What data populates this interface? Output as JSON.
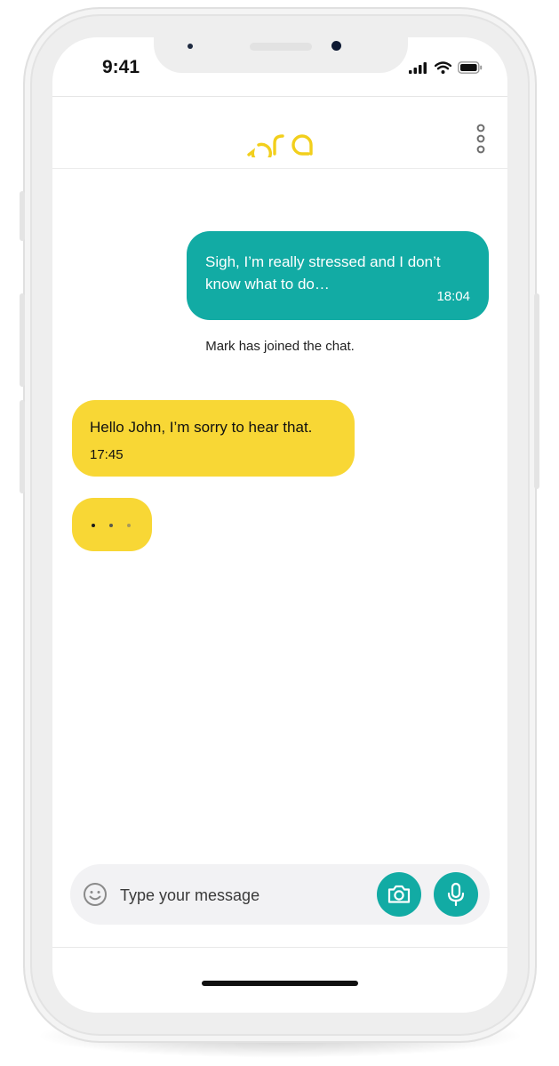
{
  "status_bar": {
    "time": "9:41"
  },
  "header": {
    "logo_text": "ora",
    "menu_icon": "more-vertical-icon"
  },
  "messages": {
    "outgoing": {
      "text": "Sigh, I’m really stressed and I don’t know what to do…",
      "time": "18:04"
    },
    "system": {
      "text": "Mark has joined the chat."
    },
    "incoming": {
      "text": "Hello John, I’m sorry to hear that.",
      "time": "17:45"
    },
    "typing_indicator": {
      "icon": "typing-dots-icon"
    }
  },
  "composer": {
    "placeholder": "Type your message",
    "emoji_icon": "smiley-icon",
    "camera_icon": "camera-icon",
    "mic_icon": "microphone-icon"
  },
  "colors": {
    "brand_yellow": "#f8d735",
    "brand_teal": "#12aba4",
    "logo_yellow": "#f2cf1c"
  }
}
